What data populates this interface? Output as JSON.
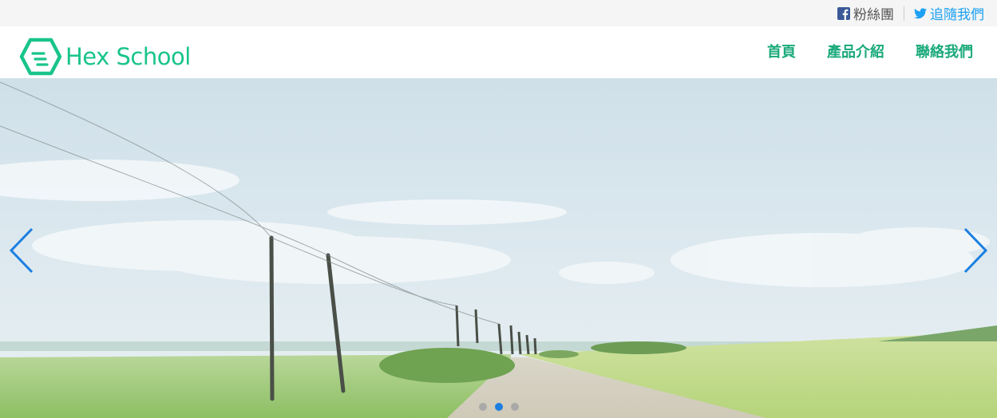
{
  "topbar": {
    "facebook": {
      "icon": "facebook-icon",
      "label": "粉絲團",
      "color": "#3b5998"
    },
    "twitter": {
      "icon": "twitter-icon",
      "label": "追隨我們",
      "color": "#1da1f2"
    }
  },
  "header": {
    "logo_text": "Hex School",
    "brand_color": "#19c48a",
    "nav": [
      {
        "label": "首頁"
      },
      {
        "label": "產品介紹"
      },
      {
        "label": "聯絡我們"
      }
    ]
  },
  "carousel": {
    "prev_icon": "chevron-left-icon",
    "next_icon": "chevron-right-icon",
    "accent": "#1b7fe0",
    "slide_count": 3,
    "active_index": 1
  }
}
